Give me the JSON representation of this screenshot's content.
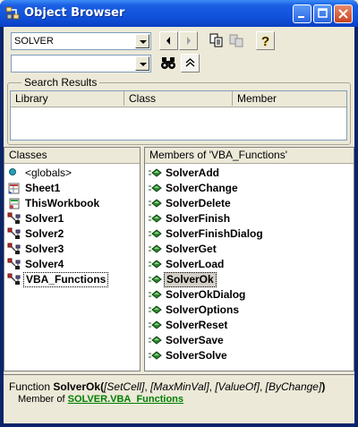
{
  "window": {
    "title": "Object Browser"
  },
  "toolbar": {
    "library_combo_value": "SOLVER",
    "search_combo_value": ""
  },
  "search_results": {
    "label": "Search Results",
    "columns": [
      "Library",
      "Class",
      "Member"
    ]
  },
  "classes": {
    "header": "Classes",
    "items": [
      {
        "label": "<globals>",
        "icon": "globals-icon",
        "bold": false
      },
      {
        "label": "Sheet1",
        "icon": "sheet-icon",
        "bold": true
      },
      {
        "label": "ThisWorkbook",
        "icon": "workbook-icon",
        "bold": true
      },
      {
        "label": "Solver1",
        "icon": "module-icon",
        "bold": true
      },
      {
        "label": "Solver2",
        "icon": "module-icon",
        "bold": true
      },
      {
        "label": "Solver3",
        "icon": "module-icon",
        "bold": true
      },
      {
        "label": "Solver4",
        "icon": "module-icon",
        "bold": true
      },
      {
        "label": "VBA_Functions",
        "icon": "module-icon",
        "bold": true,
        "focused": true
      }
    ]
  },
  "members": {
    "header": "Members of 'VBA_Functions'",
    "items": [
      {
        "label": "SolverAdd"
      },
      {
        "label": "SolverChange"
      },
      {
        "label": "SolverDelete"
      },
      {
        "label": "SolverFinish"
      },
      {
        "label": "SolverFinishDialog"
      },
      {
        "label": "SolverGet"
      },
      {
        "label": "SolverLoad"
      },
      {
        "label": "SolverOk",
        "selected": true
      },
      {
        "label": "SolverOkDialog"
      },
      {
        "label": "SolverOptions"
      },
      {
        "label": "SolverReset"
      },
      {
        "label": "SolverSave"
      },
      {
        "label": "SolverSolve"
      }
    ]
  },
  "details": {
    "prefix": "Function ",
    "name": "SolverOk",
    "open": "(",
    "args": [
      {
        "text": "[SetCell]",
        "sep": ", "
      },
      {
        "text": "[MaxMinVal]",
        "sep": ", "
      },
      {
        "text": "[ValueOf]",
        "sep": ", "
      },
      {
        "text": "[ByChange]",
        "sep": ""
      }
    ],
    "close": ")",
    "member_of_label": "Member of ",
    "library_link": "SOLVER",
    "dot": ".",
    "module_link": "VBA_Functions"
  },
  "colors": {
    "titlebar": "#0f4fd8",
    "method_icon": "#2d8a2d",
    "link": "#008000"
  }
}
